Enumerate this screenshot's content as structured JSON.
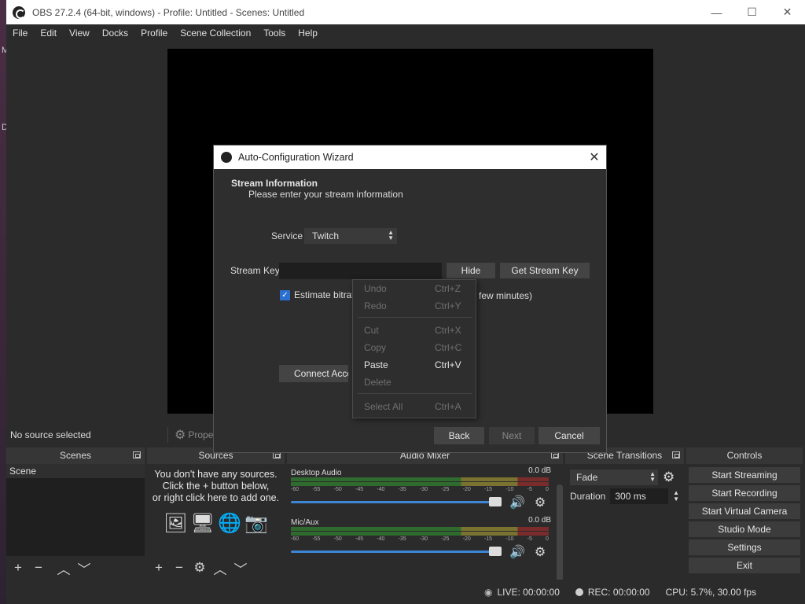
{
  "window": {
    "title": "OBS 27.2.4 (64-bit, windows) - Profile: Untitled - Scenes: Untitled",
    "minimize": "—",
    "maximize": "☐",
    "close": "✕"
  },
  "desktop_edge": {
    "letters": [
      "M",
      "D"
    ]
  },
  "menubar": [
    "File",
    "Edit",
    "View",
    "Docks",
    "Profile",
    "Scene Collection",
    "Tools",
    "Help"
  ],
  "source_toolbar": {
    "no_source": "No source selected",
    "properties": "Propert"
  },
  "docks": {
    "scenes": {
      "title": "Scenes",
      "items": [
        "Scene"
      ]
    },
    "sources": {
      "title": "Sources",
      "empty_line1": "You don't have any sources.",
      "empty_line2": "Click the + button below,",
      "empty_line3": "or right click here to add one."
    },
    "mixer": {
      "title": "Audio Mixer",
      "tracks": [
        {
          "name": "Desktop Audio",
          "db": "0.0 dB"
        },
        {
          "name": "Mic/Aux",
          "db": "0.0 dB"
        }
      ],
      "ticks": [
        "-60",
        "-55",
        "-50",
        "-45",
        "-40",
        "-35",
        "-30",
        "-25",
        "-20",
        "-15",
        "-10",
        "-5",
        "0"
      ]
    },
    "transitions": {
      "title": "Scene Transitions",
      "selected": "Fade",
      "duration_label": "Duration",
      "duration_value": "300 ms"
    },
    "controls": {
      "title": "Controls",
      "buttons": [
        "Start Streaming",
        "Start Recording",
        "Start Virtual Camera",
        "Studio Mode",
        "Settings",
        "Exit"
      ]
    }
  },
  "status": {
    "live": "LIVE: 00:00:00",
    "rec": "REC: 00:00:00",
    "cpu": "CPU: 5.7%, 30.00 fps"
  },
  "wizard": {
    "title": "Auto-Configuration Wizard",
    "heading": "Stream Information",
    "subheading": "Please enter your stream information",
    "service_label": "Service",
    "service_value": "Twitch",
    "stream_key_label": "Stream Key",
    "stream_key_value": "",
    "hide_button": "Hide",
    "get_key_button": "Get Stream Key",
    "estimate_label": "Estimate bitrat",
    "estimate_tail": "few minutes)",
    "estimate_checked": true,
    "connect_button": "Connect Accou",
    "back_button": "Back",
    "next_button": "Next",
    "cancel_button": "Cancel"
  },
  "context_menu": {
    "items": [
      {
        "label": "Undo",
        "shortcut": "Ctrl+Z",
        "enabled": false
      },
      {
        "label": "Redo",
        "shortcut": "Ctrl+Y",
        "enabled": false
      },
      {
        "label": "Cut",
        "shortcut": "Ctrl+X",
        "enabled": false
      },
      {
        "label": "Copy",
        "shortcut": "Ctrl+C",
        "enabled": false
      },
      {
        "label": "Paste",
        "shortcut": "Ctrl+V",
        "enabled": true
      },
      {
        "label": "Delete",
        "shortcut": "",
        "enabled": false
      },
      {
        "label": "Select All",
        "shortcut": "Ctrl+A",
        "enabled": false
      }
    ]
  },
  "colors": {
    "accent": "#3d86d6",
    "checkbox": "#2a6fd1",
    "panel": "#2b2b2b"
  }
}
